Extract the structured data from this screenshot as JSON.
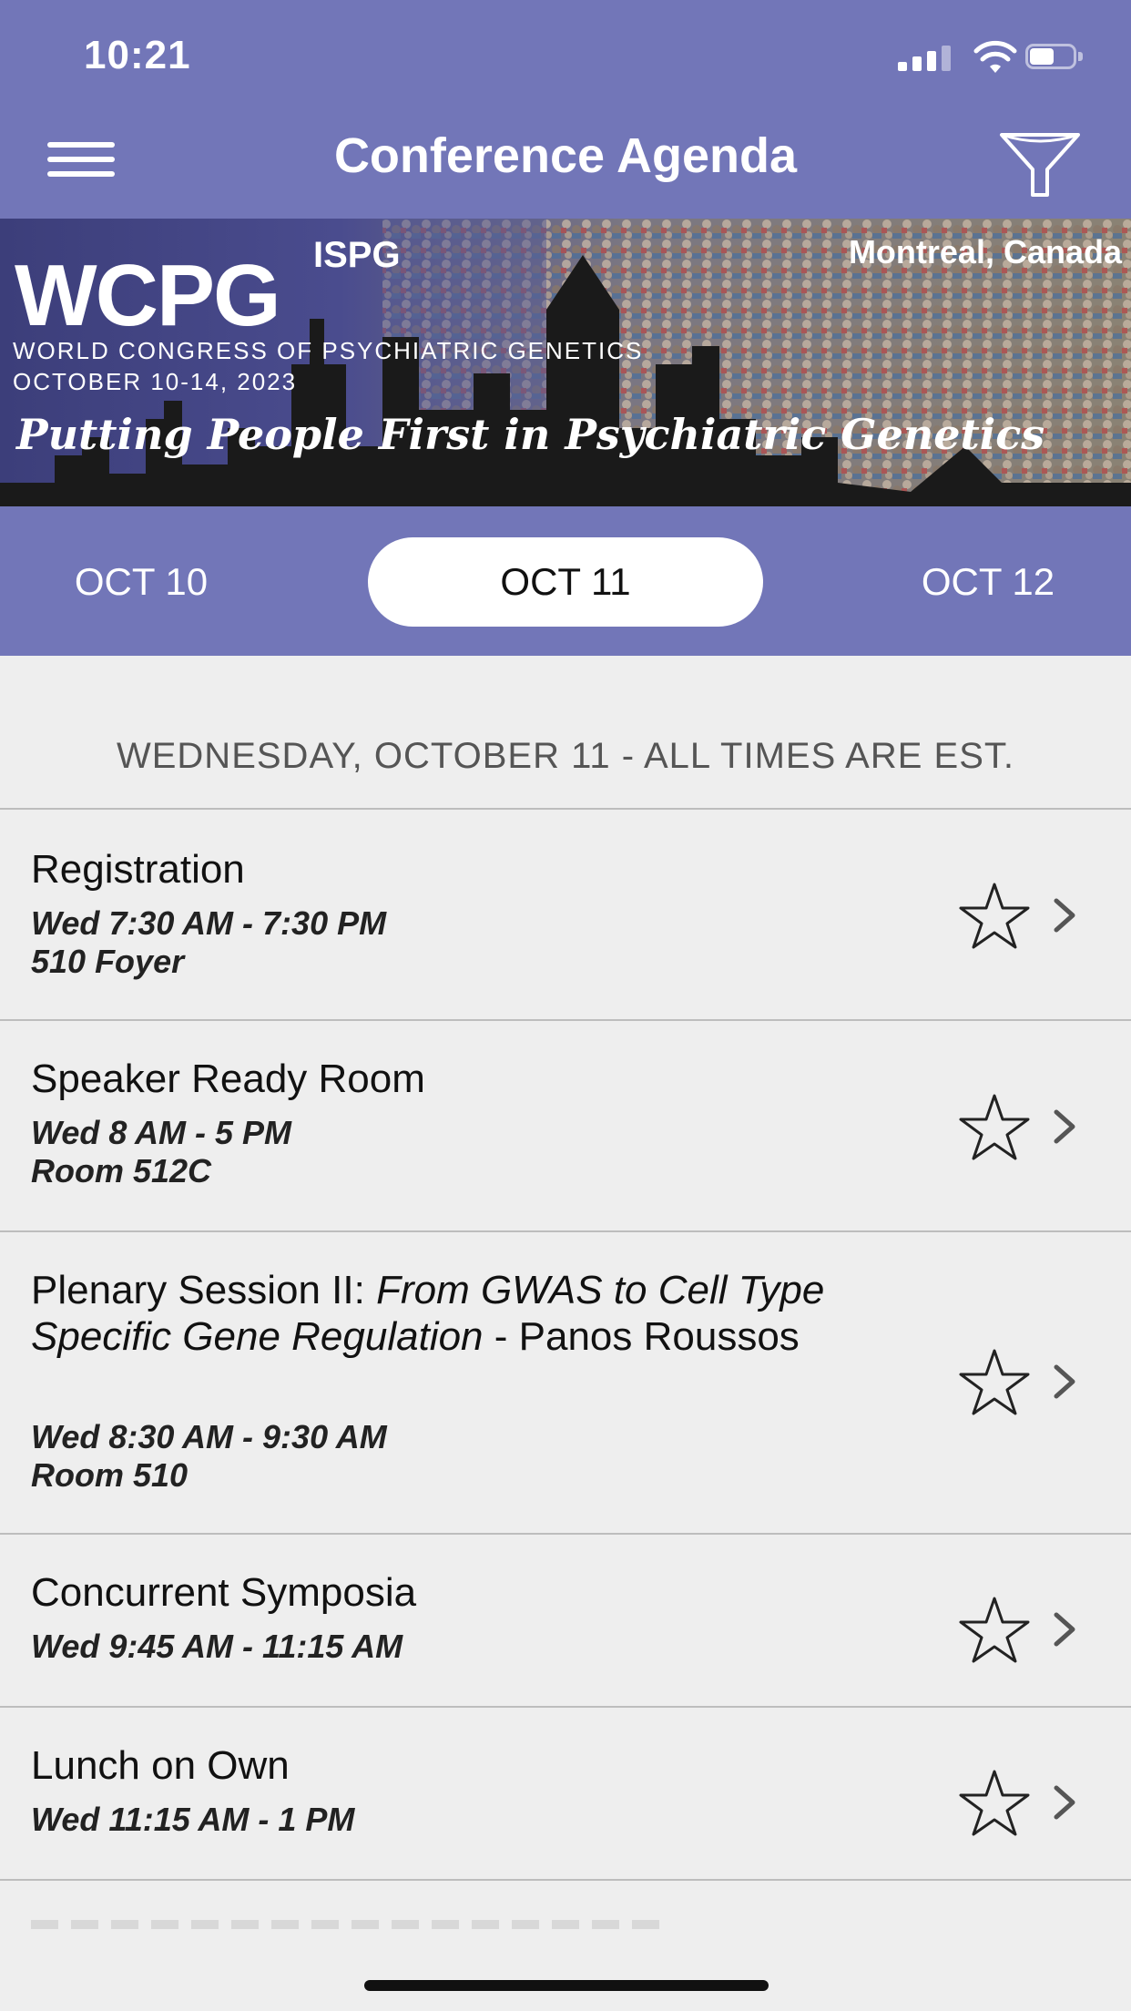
{
  "status_bar": {
    "time": "10:21"
  },
  "header": {
    "title": "Conference Agenda"
  },
  "banner": {
    "logo": "WCPG",
    "subtitle_line1": "WORLD CONGRESS OF PSYCHIATRIC GENETICS",
    "subtitle_line2": "OCTOBER 10-14, 2023",
    "tagline": "Putting People First in Psychiatric Genetics",
    "partner_logo": "ISPG",
    "location": "Montreal, Canada"
  },
  "date_tabs": [
    {
      "label": "OCT 10",
      "active": false
    },
    {
      "label": "OCT 11",
      "active": true
    },
    {
      "label": "OCT 12",
      "active": false
    }
  ],
  "day_header": "WEDNESDAY, OCTOBER 11 - ALL TIMES ARE EST.",
  "sessions": [
    {
      "title": "Registration",
      "time": "Wed 7:30 AM - 7:30 PM",
      "room": "510 Foyer"
    },
    {
      "title": "Speaker Ready Room",
      "time": "Wed 8 AM - 5 PM",
      "room": "Room 512C"
    },
    {
      "title_prefix": "Plenary Session II: ",
      "title_italic": "From GWAS to Cell Type Specific Gene Regulation",
      "title_suffix": " - Panos Roussos",
      "time": "Wed 8:30 AM - 9:30 AM",
      "room": "Room 510"
    },
    {
      "title": "Concurrent Symposia",
      "time": "Wed 9:45 AM - 11:15 AM"
    },
    {
      "title": "Lunch on Own",
      "time": "Wed 11:15 AM - 1 PM"
    }
  ],
  "colors": {
    "accent": "#7276b8",
    "background": "#eeeeee"
  }
}
